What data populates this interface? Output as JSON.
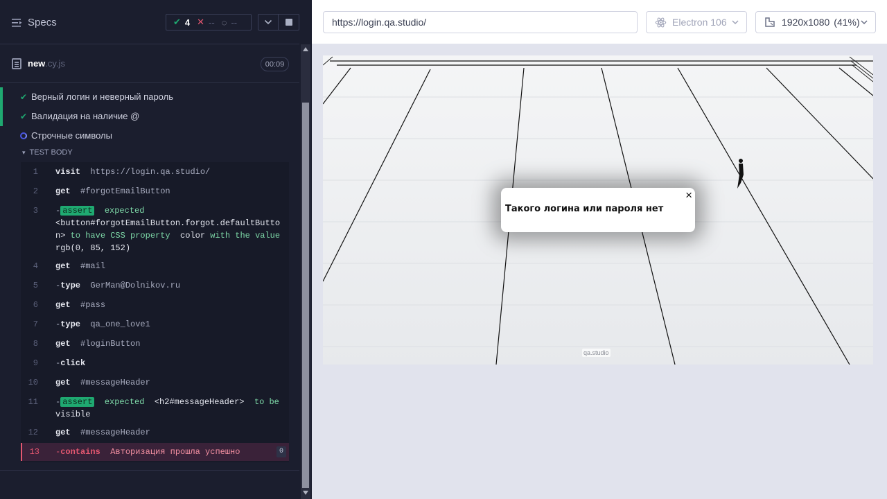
{
  "header": {
    "specs_label": "Specs",
    "passed_count": "4",
    "failed_count": "--",
    "pending_count": "--"
  },
  "file": {
    "name": "new",
    "ext": ".cy.js",
    "timer": "00:09"
  },
  "tests": [
    {
      "title": "Верный логин и неверный пароль",
      "status": "passed"
    },
    {
      "title": "Валидация на наличие @",
      "status": "passed"
    },
    {
      "title": "Строчные символы",
      "status": "running"
    }
  ],
  "test_body_label": "TEST BODY",
  "commands": [
    {
      "n": "1",
      "name": "visit",
      "arg": "https://login.qa.studio/"
    },
    {
      "n": "2",
      "name": "get",
      "arg": "#forgotEmailButton"
    },
    {
      "n": "3",
      "badge": "assert",
      "msg1": "expected",
      "hl1": "<button#forgotEmailButton.forgot.defaultButton>",
      "msg2": "to have CSS property",
      "hl2": "color",
      "msg3": "with the value",
      "hl3": "rgb(0, 85, 152)"
    },
    {
      "n": "4",
      "name": "get",
      "arg": "#mail"
    },
    {
      "n": "5",
      "name": "type",
      "arg": "GerMan@Dolnikov.ru"
    },
    {
      "n": "6",
      "name": "get",
      "arg": "#pass"
    },
    {
      "n": "7",
      "name": "type",
      "arg": "qa_one_love1"
    },
    {
      "n": "8",
      "name": "get",
      "arg": "#loginButton"
    },
    {
      "n": "9",
      "name": "click",
      "arg": ""
    },
    {
      "n": "10",
      "name": "get",
      "arg": "#messageHeader"
    },
    {
      "n": "11",
      "badge": "assert",
      "msg1": "expected",
      "hl1": "<h2#messageHeader>",
      "msg2": "to be",
      "hl2": "visible"
    },
    {
      "n": "12",
      "name": "get",
      "arg": "#messageHeader"
    },
    {
      "n": "13",
      "name": "contains",
      "arg": "Авторизация прошла успешно",
      "count": "0"
    }
  ],
  "browser": {
    "url": "https://login.qa.studio/",
    "name": "Electron 106",
    "viewport": "1920x1080",
    "scale": "(41%)"
  },
  "app": {
    "message": "Такого логина или пароля нет",
    "close_glyph": "×",
    "watermark": "qa.studio"
  },
  "colors": {
    "passed": "#1fa971",
    "failed": "#e45770",
    "running": "#4956e3",
    "sidebar_bg": "#1b1e2e"
  },
  "icons": [
    "specs-icon",
    "check-icon",
    "x-icon",
    "spinner-icon",
    "chevron-down-icon",
    "stop-icon",
    "file-icon",
    "electron-icon",
    "viewport-icon",
    "close-icon"
  ]
}
